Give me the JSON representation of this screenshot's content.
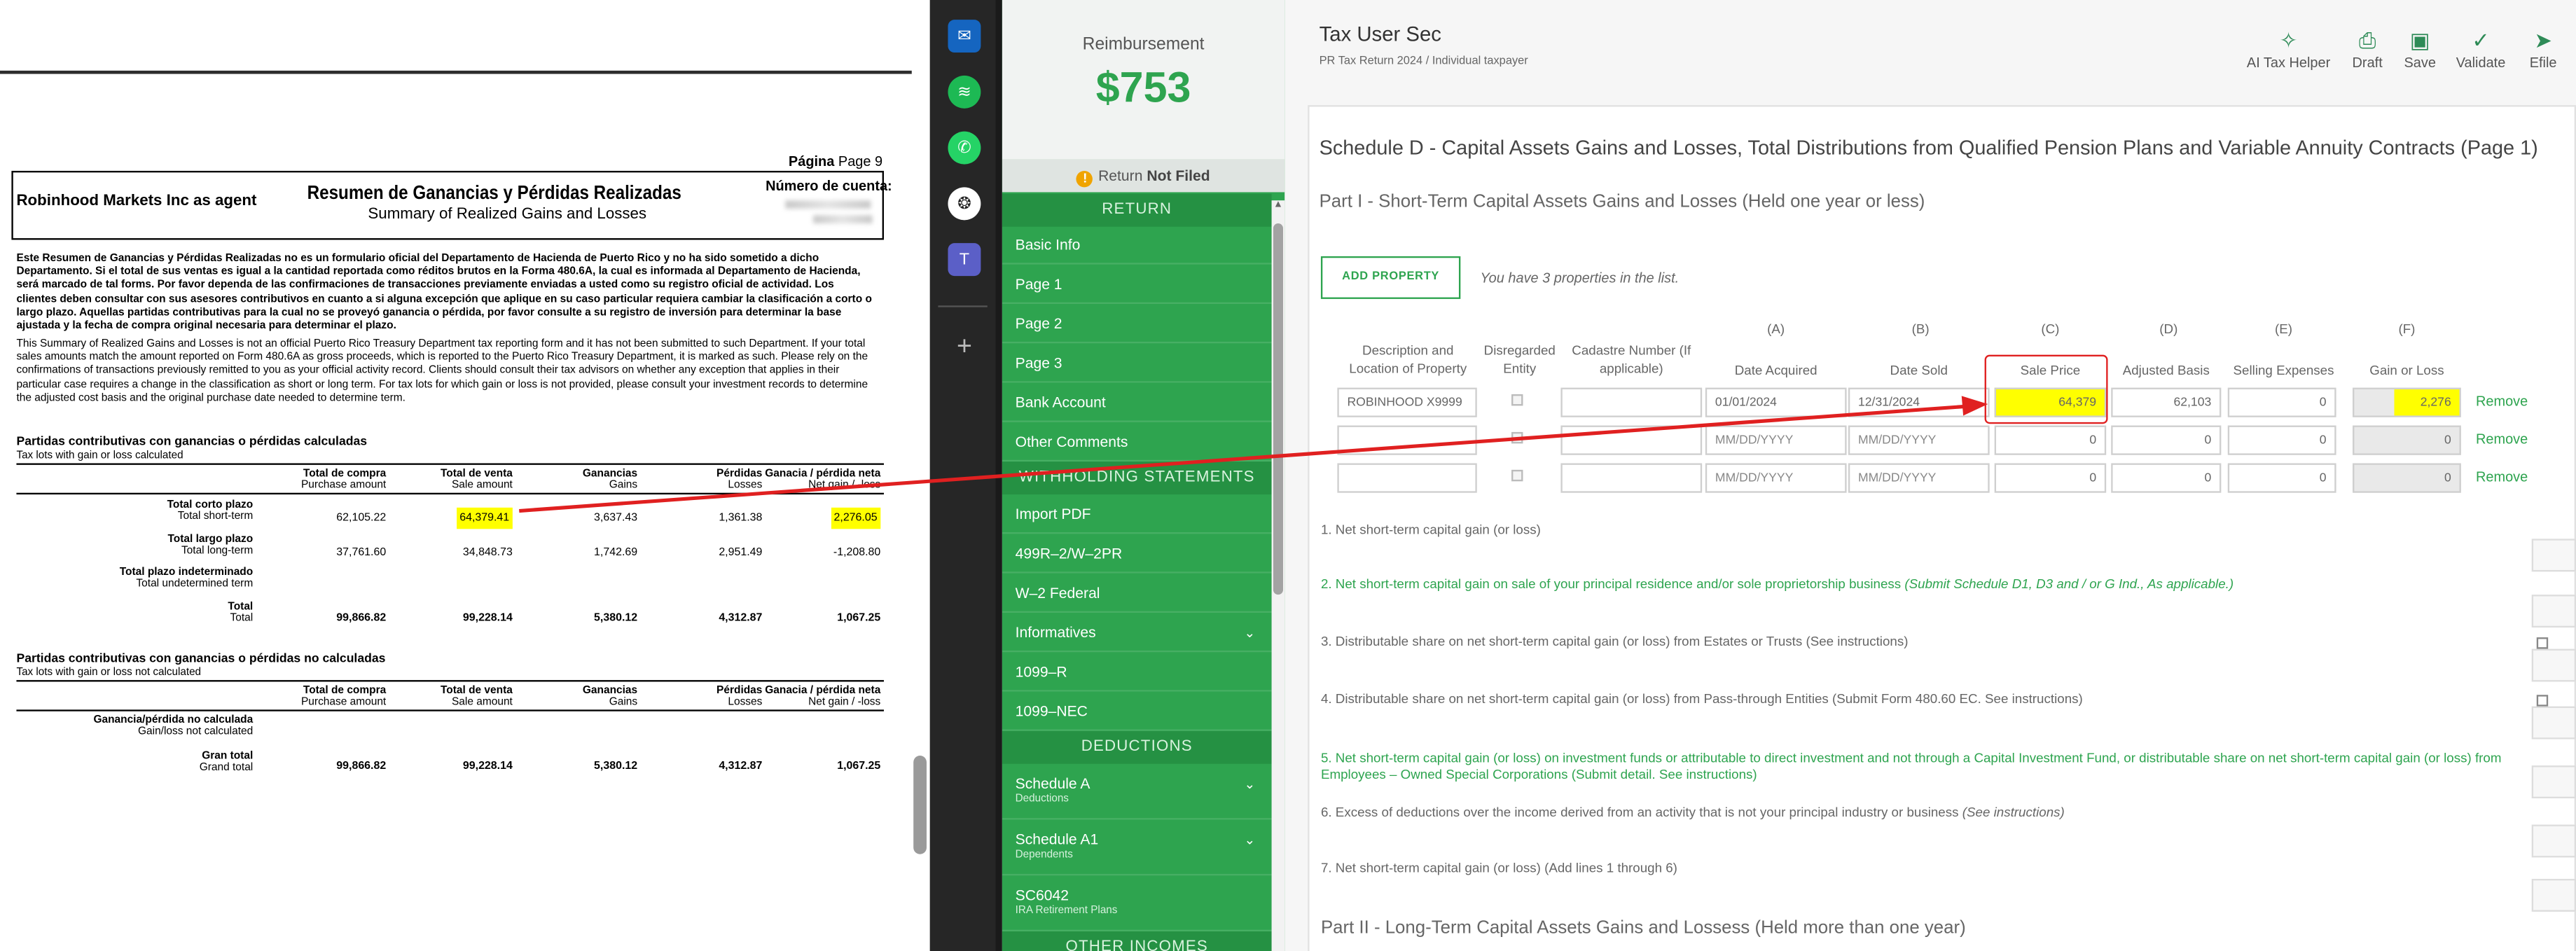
{
  "pdf": {
    "page_label": "Página",
    "page_value": "Page 9",
    "agent": "Robinhood Markets Inc as agent",
    "title_es": "Resumen de Ganancias y Pérdidas Realizadas",
    "title_en": "Summary of Realized Gains and Losses",
    "account_label": "Número de cuenta:",
    "para_es": "Este Resumen de Ganancias y Pérdidas Realizadas no es un formulario oficial del Departamento de Hacienda de Puerto Rico y no ha sido sometido a dicho Departamento. Si el total de sus ventas es igual a la cantidad reportada como réditos brutos en la Forma 480.6A, la cual es informada al Departamento de Hacienda, será marcado de tal forms. Por favor dependa de las confirmaciones de transacciones previamente enviadas a usted como su registro oficial de actividad. Los clientes deben consultar con sus asesores contributivos en cuanto a si alguna excepción que aplique en su caso particular requiera cambiar la clasificación a corto o largo plazo. Aquellas partidas contributivas para la cual no se proveyó ganancia o pérdida, por favor consulte a su registro de inversión para determinar la base ajustada y la fecha de compra original necesaria para determinar el plazo.",
    "para_en": "This Summary of Realized Gains and Losses is not an official Puerto Rico Treasury Department tax reporting form and it has not been submitted to such Department. If your total sales amounts match the amount reported on Form 480.6A as gross proceeds, which is reported to the Puerto Rico Treasury Department, it is marked as such. Please rely on the confirmations of transactions previously remitted to you as your official activity record. Clients should consult their tax advisors on whether any exception that applies in their particular case requires a change in the classification as short or long term. For tax lots for which gain or loss is not provided, please consult your investment records to determine the adjusted cost basis and the original purchase date needed to determine term.",
    "sec1_title": "Partidas contributivas con ganancias o pérdidas calculadas",
    "sec1_sub": "Tax lots with gain or loss calculated",
    "sec2_title": "Partidas contributivas con ganancias o pérdidas no calculadas",
    "sec2_sub": "Tax lots with gain or loss not calculated",
    "col_headers": [
      {
        "es": "Total de compra",
        "en": "Purchase amount"
      },
      {
        "es": "Total de venta",
        "en": "Sale amount"
      },
      {
        "es": "Ganancias",
        "en": "Gains"
      },
      {
        "es": "Pérdidas",
        "en": "Losses"
      },
      {
        "es": "Ganacia / pérdida neta",
        "en": "Net gain / -loss"
      }
    ],
    "rows1": [
      {
        "es": "Total corto plazo",
        "en": "Total short-term",
        "v": [
          "62,105.22",
          "64,379.41",
          "3,637.43",
          "1,361.38",
          "2,276.05"
        ]
      },
      {
        "es": "Total largo plazo",
        "en": "Total long-term",
        "v": [
          "37,761.60",
          "34,848.73",
          "1,742.69",
          "2,951.49",
          "-1,208.80"
        ]
      },
      {
        "es": "Total plazo indeterminado",
        "en": "Total undetermined term",
        "v": [
          "",
          "",
          "",
          "",
          ""
        ]
      },
      {
        "es": "Total",
        "en": "Total",
        "v": [
          "99,866.82",
          "99,228.14",
          "5,380.12",
          "4,312.87",
          "1,067.25"
        ]
      }
    ],
    "rows2": [
      {
        "es": "Ganancia/pérdida no calculada",
        "en": "Gain/loss not calculated",
        "v": [
          "",
          "",
          "",
          "",
          ""
        ]
      },
      {
        "es": "Gran total",
        "en": "Grand total",
        "v": [
          "99,866.82",
          "99,228.14",
          "5,380.12",
          "4,312.87",
          "1,067.25"
        ]
      }
    ],
    "highlight_color": "#ffff00"
  },
  "nav": {
    "reimbursement_label": "Reimbursement",
    "reimbursement_amount": "$753",
    "status_prefix": "Return",
    "status_value": "Not Filed",
    "sections": [
      "RETURN",
      "WITHHOLDING STATEMENTS",
      "DEDUCTIONS",
      "OTHER INCOMES"
    ],
    "return_items": [
      "Basic Info",
      "Page 1",
      "Page 2",
      "Page 3",
      "Bank Account",
      "Other Comments"
    ],
    "withholding_items": [
      "Import PDF",
      "499R–2/W–2PR",
      "W–2 Federal",
      "Informatives",
      "1099–R",
      "1099–NEC"
    ],
    "deduction_items": [
      {
        "label": "Schedule A",
        "sub": "Deductions"
      },
      {
        "label": "Schedule A1",
        "sub": "Dependents"
      },
      {
        "label": "SC6042",
        "sub": "IRA Retirement Plans"
      }
    ],
    "accent": "#2ea44f"
  },
  "main": {
    "app_title": "Tax User Sec",
    "app_subtitle": "PR Tax Return 2024 / Individual taxpayer",
    "toolbar": [
      "AI Tax Helper",
      "Draft",
      "Save",
      "Validate",
      "Efile"
    ],
    "schedule_title": "Schedule D - Capital Assets Gains and Losses, Total Distributions from Qualified Pension Plans and Variable Annuity Contracts (Page 1)",
    "part1_title": "Part I - Short-Term Capital Assets Gains and Losses (Held one year or less)",
    "add_property": "ADD PROPERTY",
    "property_count": "You have 3 properties in the list.",
    "col_letters": [
      "(A)",
      "(B)",
      "(C)",
      "(D)",
      "(E)",
      "(F)"
    ],
    "columns": [
      "Description and Location of Property",
      "Disregarded Entity",
      "Cadastre Number (If applicable)",
      "Date Acquired",
      "Date Sold",
      "Sale Price",
      "Adjusted Basis",
      "Selling Expenses",
      "Gain or Loss"
    ],
    "rows": [
      {
        "desc": "ROBINHOOD X9999",
        "acq": "01/01/2024",
        "sold": "12/31/2024",
        "price": "64,379",
        "basis": "62,103",
        "exp": "0",
        "gain": "2,276"
      },
      {
        "desc": "",
        "acq": "",
        "sold": "",
        "price": "0",
        "basis": "0",
        "exp": "0",
        "gain": "0"
      },
      {
        "desc": "",
        "acq": "",
        "sold": "",
        "price": "0",
        "basis": "0",
        "exp": "0",
        "gain": "0"
      }
    ],
    "date_placeholder": "MM/DD/YYYY",
    "remove_label": "Remove",
    "lines": [
      {
        "text": "1. Net short-term capital gain (or loss)",
        "note": ""
      },
      {
        "text": "2. Net short-term capital gain on sale of your principal residence and/or sole proprietorship business",
        "note": "(Submit Schedule D1, D3 and / or G Ind., As applicable.)"
      },
      {
        "text": "3. Distributable share on net short-term capital gain (or loss) from Estates or Trusts (See instructions)",
        "note": ""
      },
      {
        "text": "4. Distributable share on net short-term capital gain (or loss) from Pass-through Entities (Submit Form 480.60 EC. See instructions)",
        "note": ""
      },
      {
        "text": "5. Net short-term capital gain (or loss) on investment funds or attributable to direct investment and not through a Capital Investment Fund, or distributable share on net short-term capital gain (or loss) from Employees – Owned Special Corporations (Submit detail. See instructions)",
        "note": ""
      },
      {
        "text": "6. Excess of deductions over the income derived from an activity that is not your principal industry or business",
        "note": "(See instructions)"
      },
      {
        "text": "7. Net short-term capital gain (or loss) (Add lines 1 through 6)",
        "note": "(Add lines 1 through 6)"
      }
    ],
    "part2_title": "Part II - Long-Term Capital Assets Gains and Lossess (Held more than one year)",
    "highlight_color": "#ffff00",
    "arrow_color": "#e02020"
  }
}
